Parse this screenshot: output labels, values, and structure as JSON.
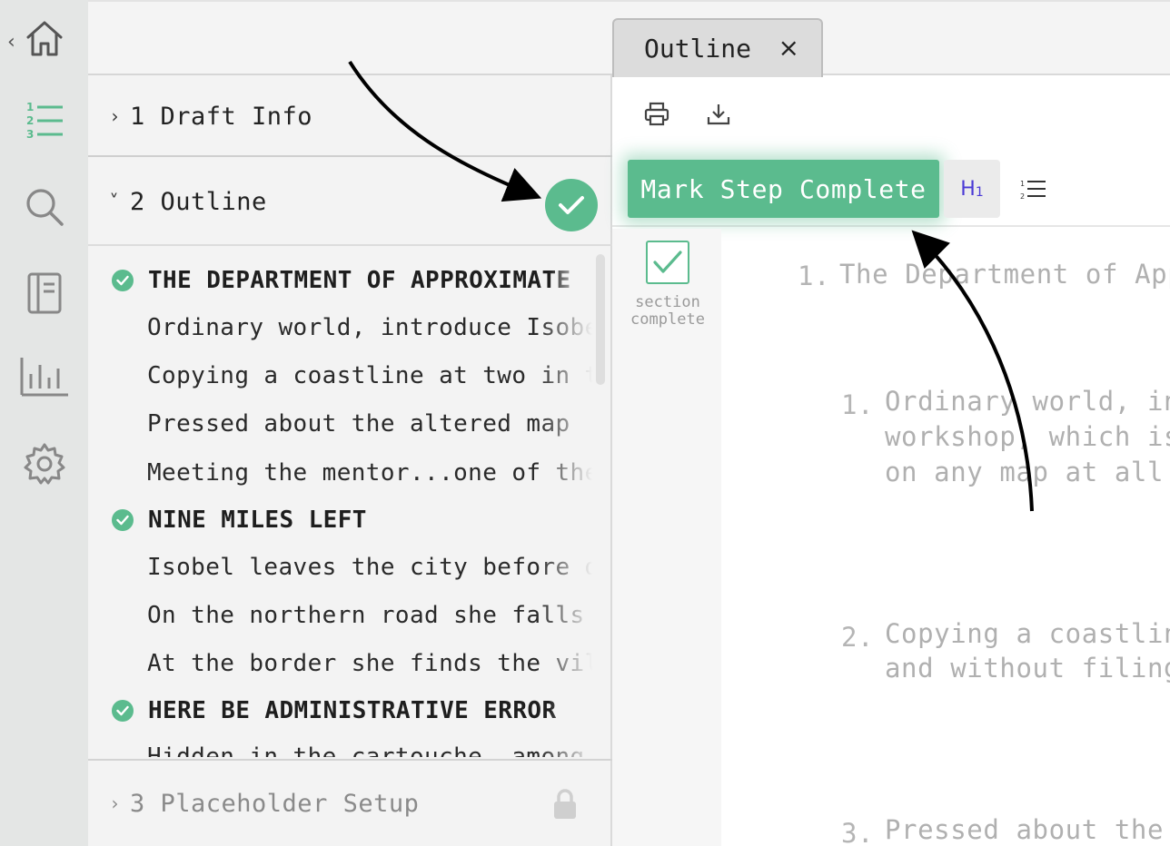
{
  "rail": {
    "items": [
      {
        "name": "home-icon"
      },
      {
        "name": "outline-list-icon",
        "accent": "#5bbb8e"
      },
      {
        "name": "search-icon"
      },
      {
        "name": "notebook-icon"
      },
      {
        "name": "stats-icon"
      },
      {
        "name": "settings-icon"
      }
    ]
  },
  "sidebar": {
    "sections": [
      {
        "chevron": "›",
        "label": "1 Draft Info"
      },
      {
        "chevron": "˅",
        "label": "2 Outline"
      },
      {
        "chevron": "›",
        "label": "3 Placeholder Setup"
      }
    ],
    "outline_items": [
      {
        "type": "heading",
        "text": "THE DEPARTMENT OF APPROXIMATE MAPS"
      },
      {
        "type": "child",
        "text": "Ordinary world, introduce Isobel"
      },
      {
        "type": "child",
        "text": "Copying a coastline at two in the morning"
      },
      {
        "type": "child",
        "text": "Pressed about the altered map"
      },
      {
        "type": "child",
        "text": "Meeting the mentor...one of the"
      },
      {
        "type": "heading",
        "text": "NINE MILES LEFT"
      },
      {
        "type": "child",
        "text": "Isobel leaves the city before dawn"
      },
      {
        "type": "child",
        "text": "On the northern road she falls"
      },
      {
        "type": "child",
        "text": "At the border she finds the village"
      },
      {
        "type": "heading",
        "text": "HERE BE ADMINISTRATIVE ERROR"
      },
      {
        "type": "child",
        "text": "Hidden in the cartouche, among"
      }
    ]
  },
  "tabs": [
    {
      "label": "Outline",
      "close": "×"
    }
  ],
  "toolbar": {
    "mark_complete": "Mark Step Complete",
    "h1_main": "H",
    "h1_sub": "1"
  },
  "gutter": {
    "line1": "section",
    "line2": "complete"
  },
  "document": {
    "lines": [
      {
        "num": "1.",
        "text": "The Department of Approximate Maps"
      },
      {
        "num": "1.",
        "text": "Ordinary world, introduce Isobel in the"
      },
      {
        "num": "",
        "text": "workshop, which is not"
      },
      {
        "num": "",
        "text": "on any map at all"
      },
      {
        "num": "2.",
        "text": "Copying a coastline at two in the morning"
      },
      {
        "num": "",
        "text": "and without filing"
      },
      {
        "num": "3.",
        "text": "Pressed about the altered map"
      }
    ]
  },
  "colors": {
    "accent": "#5bbb8e",
    "h1": "#4a3ad6"
  }
}
